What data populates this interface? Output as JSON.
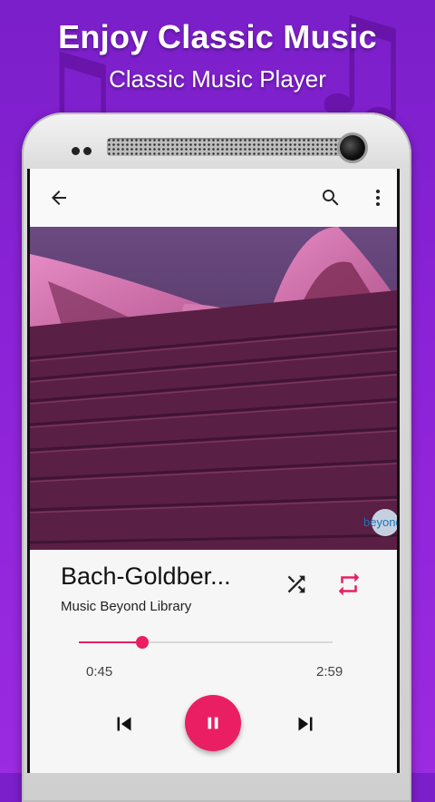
{
  "promo": {
    "headline": "Enjoy Classic Music",
    "subheadline": "Classic Music Player"
  },
  "toolbar": {
    "back_icon": "arrow-back-icon",
    "search_icon": "search-icon",
    "menu_icon": "more-vert-icon"
  },
  "album_art": {
    "watermark": "beyond"
  },
  "track": {
    "title": "Bach-Goldber...",
    "artist": "Music Beyond Library",
    "elapsed": "0:45",
    "duration": "2:59",
    "progress_fraction": 0.25
  },
  "controls": {
    "shuffle_icon": "shuffle-icon",
    "repeat_icon": "repeat-icon",
    "previous_icon": "skip-previous-icon",
    "pause_icon": "pause-icon",
    "next_icon": "skip-next-icon"
  },
  "colors": {
    "accent": "#e91e63",
    "background_purple": "#8a22d6"
  }
}
